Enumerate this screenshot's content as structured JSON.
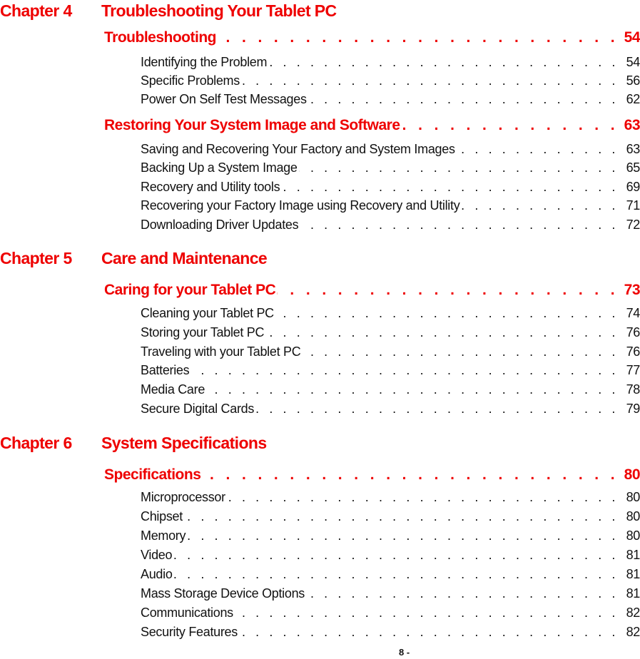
{
  "toc": {
    "chapters": [
      {
        "number": "Chapter 4",
        "title": "Troubleshooting Your Tablet PC",
        "sections": [
          {
            "title": "Troubleshooting",
            "page": "54",
            "entries": [
              {
                "title": "Identifying the Problem",
                "page": "54"
              },
              {
                "title": "Specific Problems",
                "page": "56"
              },
              {
                "title": "Power On Self Test Messages",
                "page": "62"
              }
            ]
          },
          {
            "title": "Restoring Your System Image and Software",
            "page": "63",
            "entries": [
              {
                "title": "Saving and Recovering Your Factory and System Images",
                "page": "63"
              },
              {
                "title": "Backing Up a System Image",
                "page": "65"
              },
              {
                "title": "Recovery and Utility tools",
                "page": "69"
              },
              {
                "title": "Recovering your Factory Image using Recovery and Utility",
                "page": "71"
              },
              {
                "title": "Downloading Driver Updates",
                "page": "72"
              }
            ]
          }
        ]
      },
      {
        "number": "Chapter 5",
        "title": "Care and Maintenance",
        "sections": [
          {
            "title": "Caring for your Tablet PC",
            "page": "73",
            "entries": [
              {
                "title": "Cleaning your Tablet PC",
                "page": "74"
              },
              {
                "title": "Storing your Tablet PC",
                "page": "76"
              },
              {
                "title": "Traveling with your Tablet PC",
                "page": "76"
              },
              {
                "title": "Batteries",
                "page": "77"
              },
              {
                "title": "Media Care",
                "page": "78"
              },
              {
                "title": "Secure Digital Cards",
                "page": "79"
              }
            ]
          }
        ]
      },
      {
        "number": "Chapter 6",
        "title": "System Specifications",
        "sections": [
          {
            "title": "Specifications",
            "page": "80",
            "entries": [
              {
                "title": "Microprocessor",
                "page": "80"
              },
              {
                "title": "Chipset",
                "page": "80"
              },
              {
                "title": "Memory",
                "page": "80"
              },
              {
                "title": "Video",
                "page": "81"
              },
              {
                "title": "Audio",
                "page": "81"
              },
              {
                "title": "Mass Storage Device Options",
                "page": "81"
              },
              {
                "title": "Communications",
                "page": "82"
              },
              {
                "title": "Security Features",
                "page": "82"
              }
            ]
          }
        ]
      }
    ],
    "leader_dots": ". . . . . . . . . . . . . . . . . . . . . . . . . . . . . . . . . . . . . . . . . . . . . . . . . . . . . . . . . . . . . . . . . . . . . . . . . . . . . . ."
  },
  "footer": {
    "page_label": "8 -"
  },
  "colors": {
    "heading": "#ee0000",
    "body_text": "#111111"
  }
}
